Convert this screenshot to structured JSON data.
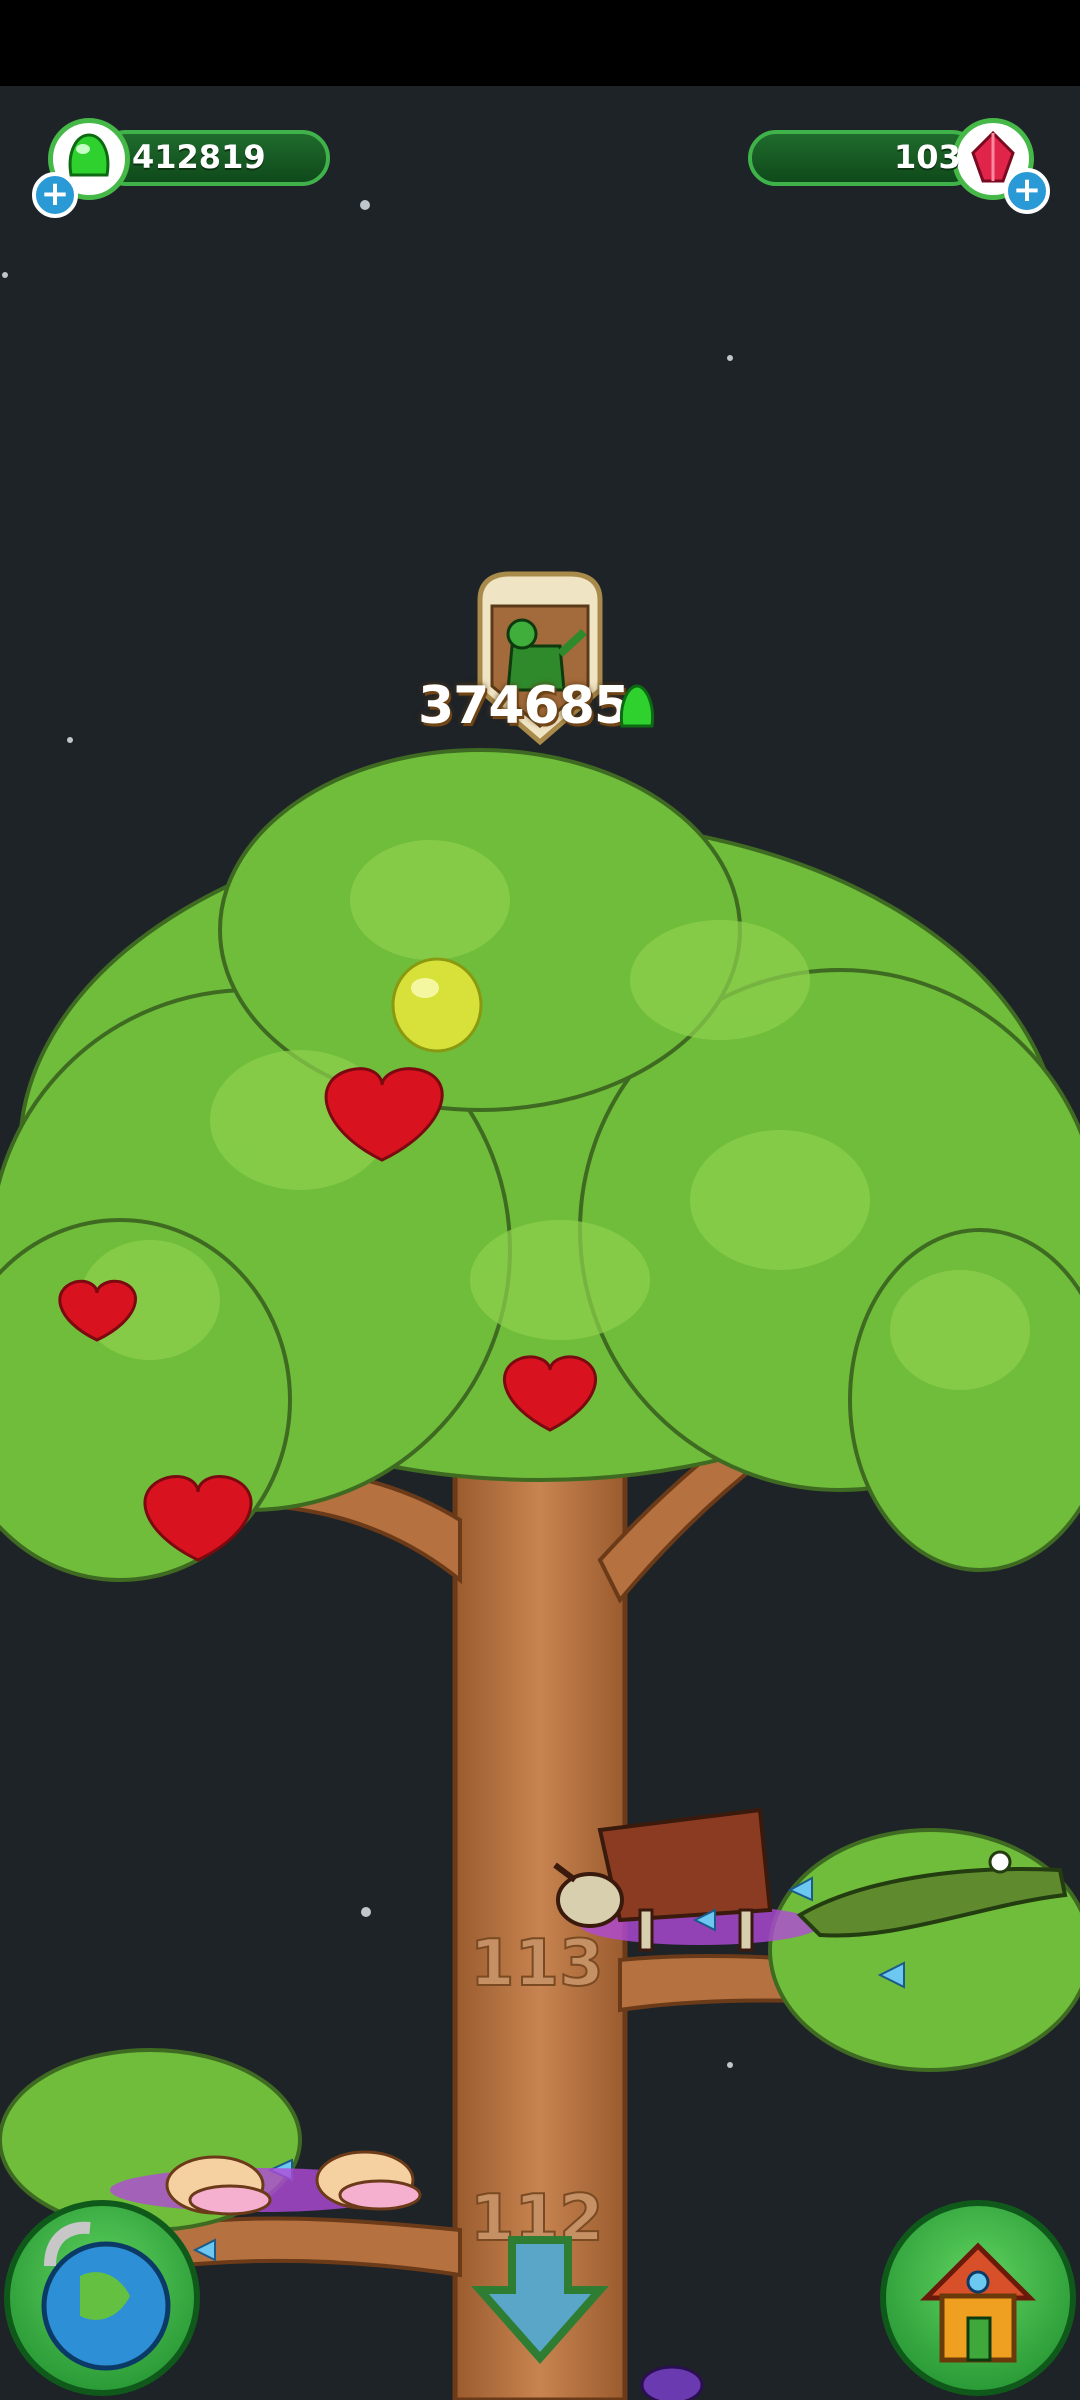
{
  "hud": {
    "gems": "412819",
    "crystals": "103"
  },
  "watering": {
    "cost": "374685"
  },
  "floors": {
    "upper": "113",
    "lower": "112"
  },
  "icons": {
    "gem": "green-gem-icon",
    "crystal": "red-crystal-icon",
    "add": "plus-icon",
    "watering_can": "watering-can-icon",
    "globe": "globe-icon",
    "house": "house-icon",
    "down_arrow": "down-arrow-icon"
  },
  "colors": {
    "background": "#1e2328",
    "hud_green": "#1f6b2c",
    "leaf": "#6fbd3a",
    "trunk": "#b5713f",
    "fruit_red": "#d8121f",
    "fruit_yellow": "#d8e03a"
  }
}
